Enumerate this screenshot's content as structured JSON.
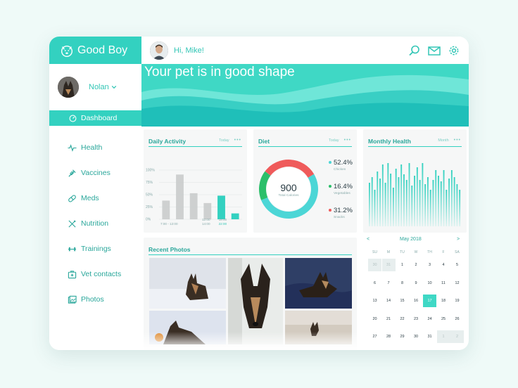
{
  "brand": {
    "name": "Good Boy"
  },
  "sidebar": {
    "profile_name": "Nolan",
    "active_item": "Dashboard",
    "items": [
      {
        "label": "Health",
        "icon": "heartbeat-icon"
      },
      {
        "label": "Vaccines",
        "icon": "syringe-icon"
      },
      {
        "label": "Meds",
        "icon": "pill-icon"
      },
      {
        "label": "Nutrition",
        "icon": "utensils-icon"
      },
      {
        "label": "Trainings",
        "icon": "dumbbell-icon"
      },
      {
        "label": "Vet contacts",
        "icon": "medical-kit-icon"
      },
      {
        "label": "Photos",
        "icon": "photos-icon"
      }
    ]
  },
  "topbar": {
    "greeting": "Hi, Mike!"
  },
  "hero": {
    "title": "Your pet is in good shape"
  },
  "colors": {
    "accent": "#33d1c0",
    "accent_dark": "#2aa79b",
    "diet_red": "#ef5b5b",
    "diet_green": "#2bbf6a",
    "diet_teal": "#4cd6d6"
  },
  "daily_activity": {
    "title": "Daily Activity",
    "filter": "Today",
    "more": "•••",
    "y_ticks": [
      "100%",
      "75%",
      "50%",
      "25%",
      "0%"
    ],
    "x_labels": [
      "7:00 - 12:00",
      "12:00",
      "14:00",
      "18:00",
      "22:00"
    ]
  },
  "diet": {
    "title": "Diet",
    "filter": "Today",
    "more": "•••",
    "total": "900",
    "total_label": "Total Calories",
    "legend": [
      {
        "pct": "52.4%",
        "label": "Chicken",
        "color": "#4cd6d6"
      },
      {
        "pct": "16.4%",
        "label": "Vegetables",
        "color": "#2bbf6a"
      },
      {
        "pct": "31.2%",
        "label": "Snacks",
        "color": "#ef5b5b"
      }
    ]
  },
  "monthly_health": {
    "title": "Monthly Health",
    "filter": "Month",
    "more": "•••"
  },
  "recent_photos": {
    "title": "Recent Photos"
  },
  "calendar": {
    "month": "May 2018",
    "prev": "<",
    "next": ">",
    "dow": [
      "SU",
      "M",
      "TU",
      "W",
      "TH",
      "F",
      "SA"
    ],
    "weeks": [
      [
        "30",
        "31",
        "1",
        "2",
        "3",
        "4",
        "5"
      ],
      [
        "6",
        "7",
        "8",
        "9",
        "10",
        "11",
        "12"
      ],
      [
        "13",
        "14",
        "15",
        "16",
        "17",
        "18",
        "19"
      ],
      [
        "20",
        "21",
        "22",
        "23",
        "24",
        "25",
        "26"
      ],
      [
        "27",
        "28",
        "29",
        "30",
        "31",
        "1",
        "2"
      ]
    ],
    "selected": "17"
  },
  "chart_data": [
    {
      "type": "bar",
      "title": "Daily Activity",
      "ylim": [
        0,
        100
      ],
      "y_ticks": [
        "100%",
        "75%",
        "50%",
        "25%",
        "0%"
      ],
      "series": [
        {
          "values": [
            38,
            91,
            53,
            33,
            48,
            0
          ]
        },
        {
          "values": [
            0,
            0,
            0,
            0,
            48,
            12
          ]
        }
      ],
      "x_labels": [
        "7:00 - 12:00",
        "12:00",
        "14:00",
        "18:00",
        "22:00"
      ],
      "grid": true
    },
    {
      "type": "pie",
      "title": "Diet",
      "labels": [
        "Chicken",
        "Vegetables",
        "Snacks"
      ],
      "values": [
        52.4,
        16.4,
        31.2
      ]
    },
    {
      "type": "bar",
      "title": "Monthly Health",
      "values": [
        62,
        70,
        52,
        78,
        68,
        88,
        62,
        90,
        75,
        55,
        82,
        70,
        88,
        74,
        66,
        90,
        58,
        72,
        84,
        66,
        90,
        60,
        70,
        52,
        66,
        80,
        72,
        64,
        80,
        52,
        68,
        80,
        70,
        60,
        52
      ]
    }
  ]
}
